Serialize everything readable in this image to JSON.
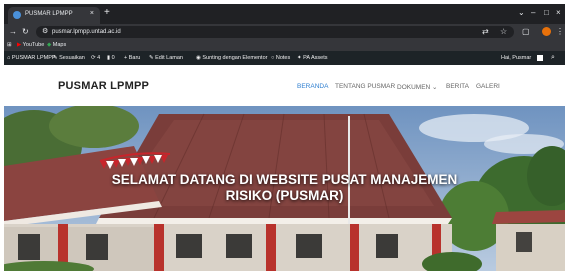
{
  "browser": {
    "tab_title": "PUSMAR LPMPP",
    "tab_close": "×",
    "new_tab": "+",
    "url": "pusmar.lpmpp.untad.ac.id",
    "window_controls": {
      "dropdown": "⌄",
      "minimize": "–",
      "maximize": "□",
      "close": "×"
    }
  },
  "bookmarks": {
    "apps": "⊞",
    "items": [
      "YouTube",
      "Maps"
    ]
  },
  "adminbar": {
    "items": [
      "PUSMAR LPMPP",
      "Sesuaikan",
      "4",
      "0",
      "+ Baru",
      "Edit Laman",
      "Sunting dengan Elementor",
      "Notes",
      "PA Assets"
    ],
    "greeting": "Hai, Pusmar"
  },
  "site": {
    "logo": "PUSMAR LPMPP",
    "nav": [
      "BERANDA",
      "TENTANG PUSMAR",
      "DOKUMEN ⌄",
      "BERITA",
      "GALERI"
    ],
    "accent": "#2f7fd0"
  },
  "hero": {
    "title_line1": "SELAMAT DATANG DI WEBSITE PUSAT MANAJEMEN",
    "title_line2": "RISIKO (PUSMAR)"
  }
}
